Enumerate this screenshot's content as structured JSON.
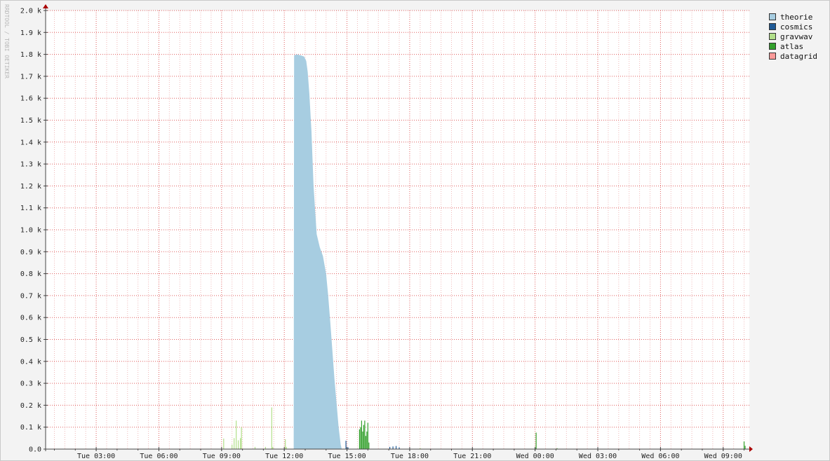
{
  "watermark": "RRDTOOL / TOBI OETIKER",
  "colors": {
    "background": "#f3f3f3",
    "canvas": "#ffffff",
    "grid_major": "#e06060",
    "grid_minor": "#f0b8b8",
    "axis": "#444444",
    "arrow": "#aa0000"
  },
  "chart_data": {
    "type": "area",
    "title": "",
    "xlabel": "",
    "ylabel": "",
    "x_start": "Tue 00:35",
    "x_end": "Wed 10:15",
    "xlim_hours": [
      0.58,
      34.25
    ],
    "ylim": [
      0,
      2000
    ],
    "y_ticks": [
      0,
      100,
      200,
      300,
      400,
      500,
      600,
      700,
      800,
      900,
      1000,
      1100,
      1200,
      1300,
      1400,
      1500,
      1600,
      1700,
      1800,
      1900,
      2000
    ],
    "y_tick_labels": [
      "0.0",
      "0.1 k",
      "0.2 k",
      "0.3 k",
      "0.4 k",
      "0.5 k",
      "0.6 k",
      "0.7 k",
      "0.8 k",
      "0.9 k",
      "1.0 k",
      "1.1 k",
      "1.2 k",
      "1.3 k",
      "1.4 k",
      "1.5 k",
      "1.6 k",
      "1.7 k",
      "1.8 k",
      "1.9 k",
      "2.0 k"
    ],
    "x_ticks_hours": [
      3,
      6,
      9,
      12,
      15,
      18,
      21,
      24,
      27,
      30,
      33
    ],
    "x_tick_labels": [
      "Tue 03:00",
      "Tue 06:00",
      "Tue 09:00",
      "Tue 12:00",
      "Tue 15:00",
      "Tue 18:00",
      "Tue 21:00",
      "Wed 00:00",
      "Wed 03:00",
      "Wed 06:00",
      "Wed 09:00"
    ],
    "grid": true,
    "legend_position": "top-right",
    "series": [
      {
        "name": "theorie",
        "color": "#a7cde1",
        "style": "area",
        "points": [
          [
            12.45,
            0
          ],
          [
            12.47,
            1795
          ],
          [
            12.6,
            1800
          ],
          [
            12.8,
            1795
          ],
          [
            12.95,
            1790
          ],
          [
            13.05,
            1770
          ],
          [
            13.12,
            1720
          ],
          [
            13.2,
            1620
          ],
          [
            13.3,
            1450
          ],
          [
            13.4,
            1200
          ],
          [
            13.55,
            980
          ],
          [
            13.7,
            920
          ],
          [
            13.85,
            880
          ],
          [
            14.0,
            800
          ],
          [
            14.1,
            700
          ],
          [
            14.2,
            580
          ],
          [
            14.3,
            450
          ],
          [
            14.4,
            320
          ],
          [
            14.5,
            210
          ],
          [
            14.6,
            100
          ],
          [
            14.7,
            20
          ],
          [
            14.75,
            0
          ]
        ]
      },
      {
        "name": "cosmics",
        "color": "#1f5a96",
        "style": "spikes",
        "points": [
          [
            14.95,
            38
          ],
          [
            15.05,
            8
          ],
          [
            17.05,
            10
          ],
          [
            17.2,
            12
          ],
          [
            17.35,
            14
          ],
          [
            17.5,
            8
          ]
        ]
      },
      {
        "name": "gravwav",
        "color": "#b2df8a",
        "style": "spikes",
        "points": [
          [
            9.1,
            48
          ],
          [
            9.5,
            20
          ],
          [
            9.6,
            50
          ],
          [
            9.7,
            130
          ],
          [
            9.8,
            40
          ],
          [
            9.9,
            50
          ],
          [
            9.95,
            100
          ],
          [
            10.6,
            10
          ],
          [
            11.1,
            10
          ],
          [
            11.4,
            190
          ],
          [
            11.45,
            10
          ],
          [
            12.05,
            45
          ],
          [
            12.1,
            10
          ],
          [
            18.5,
            5
          ]
        ]
      },
      {
        "name": "atlas",
        "color": "#33a02c",
        "style": "spikes",
        "points": [
          [
            15.6,
            90
          ],
          [
            15.65,
            100
          ],
          [
            15.7,
            130
          ],
          [
            15.75,
            80
          ],
          [
            15.8,
            110
          ],
          [
            15.85,
            130
          ],
          [
            15.9,
            60
          ],
          [
            15.95,
            80
          ],
          [
            16.0,
            120
          ],
          [
            16.05,
            30
          ],
          [
            24.0,
            5
          ],
          [
            24.05,
            75
          ],
          [
            25.05,
            4
          ],
          [
            34.0,
            35
          ],
          [
            34.05,
            15
          ]
        ]
      },
      {
        "name": "datagrid",
        "color": "#fb9a99",
        "style": "spikes",
        "points": []
      }
    ]
  }
}
